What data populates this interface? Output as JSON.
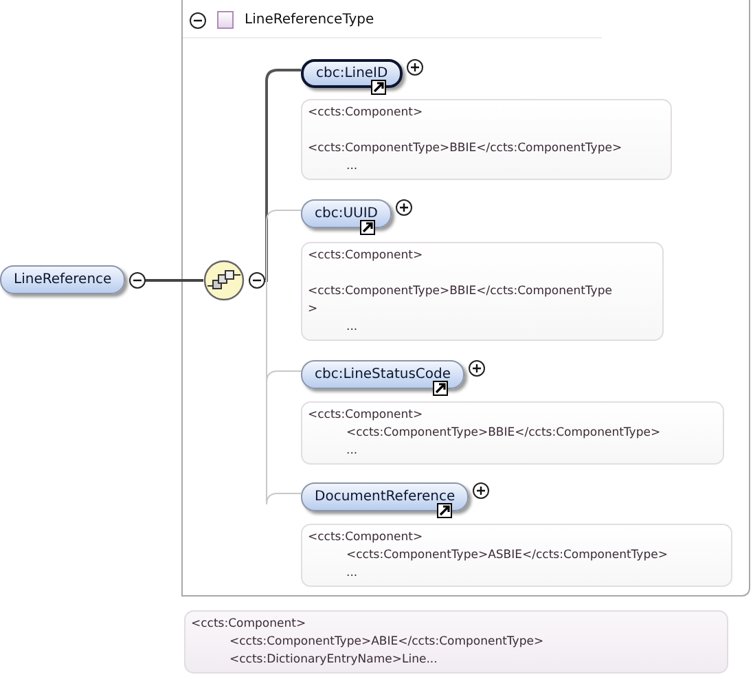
{
  "root": {
    "name": "LineReference",
    "expanded": true
  },
  "sequence": {
    "expanded": true
  },
  "type": {
    "name": "LineReferenceType",
    "expanded": true
  },
  "children": [
    {
      "name": "cbc:LineID",
      "selected": true,
      "expanded": false,
      "annotation": [
        {
          "text": "<ccts:Component>",
          "kind": "top"
        },
        {
          "text": "<ccts:ComponentType>BBIE</ccts:ComponentType>",
          "kind": "gap"
        },
        {
          "text": "...",
          "kind": "indented"
        }
      ]
    },
    {
      "name": "cbc:UUID",
      "selected": false,
      "expanded": false,
      "annotation": [
        {
          "text": "<ccts:Component>",
          "kind": "top"
        },
        {
          "text": "<ccts:ComponentType>BBIE</ccts:ComponentType",
          "kind": "gap"
        },
        {
          "text": ">",
          "kind": "top"
        },
        {
          "text": "...",
          "kind": "indented"
        }
      ]
    },
    {
      "name": "cbc:LineStatusCode",
      "selected": false,
      "expanded": false,
      "annotation": [
        {
          "text": "<ccts:Component>",
          "kind": "top"
        },
        {
          "text": "<ccts:ComponentType>BBIE</ccts:ComponentType>",
          "kind": "indented"
        },
        {
          "text": "...",
          "kind": "indented"
        }
      ]
    },
    {
      "name": "DocumentReference",
      "selected": false,
      "expanded": false,
      "annotation": [
        {
          "text": "<ccts:Component>",
          "kind": "top"
        },
        {
          "text": "<ccts:ComponentType>ASBIE</ccts:ComponentType>",
          "kind": "indented"
        },
        {
          "text": "...",
          "kind": "indented"
        }
      ]
    }
  ],
  "root_annotation": [
    {
      "text": "<ccts:Component>",
      "kind": "top"
    },
    {
      "text": "<ccts:ComponentType>ABIE</ccts:ComponentType>",
      "kind": "indented"
    },
    {
      "text": "<ccts:DictionaryEntryName>Line...",
      "kind": "indented"
    }
  ]
}
